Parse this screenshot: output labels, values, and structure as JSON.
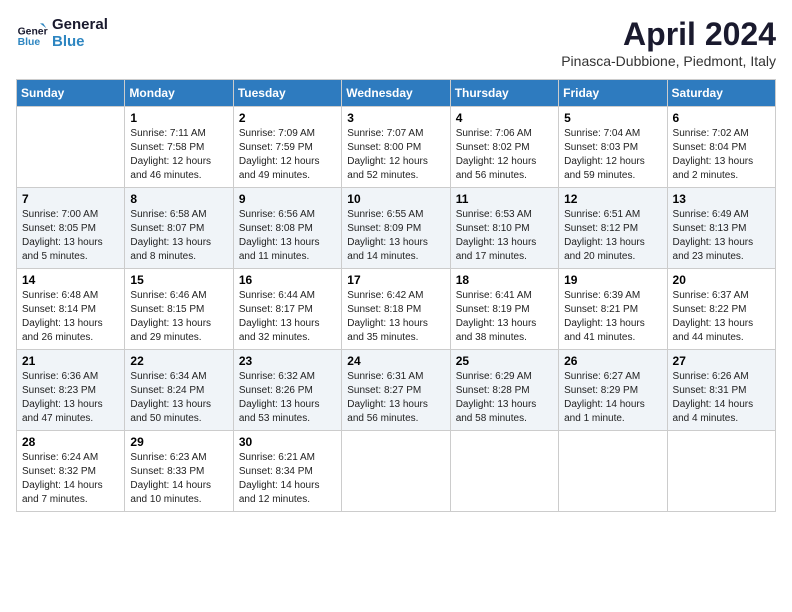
{
  "header": {
    "logo_line1": "General",
    "logo_line2": "Blue",
    "title": "April 2024",
    "subtitle": "Pinasca-Dubbione, Piedmont, Italy"
  },
  "days_of_week": [
    "Sunday",
    "Monday",
    "Tuesday",
    "Wednesday",
    "Thursday",
    "Friday",
    "Saturday"
  ],
  "weeks": [
    [
      {
        "day": "",
        "info": ""
      },
      {
        "day": "1",
        "info": "Sunrise: 7:11 AM\nSunset: 7:58 PM\nDaylight: 12 hours\nand 46 minutes."
      },
      {
        "day": "2",
        "info": "Sunrise: 7:09 AM\nSunset: 7:59 PM\nDaylight: 12 hours\nand 49 minutes."
      },
      {
        "day": "3",
        "info": "Sunrise: 7:07 AM\nSunset: 8:00 PM\nDaylight: 12 hours\nand 52 minutes."
      },
      {
        "day": "4",
        "info": "Sunrise: 7:06 AM\nSunset: 8:02 PM\nDaylight: 12 hours\nand 56 minutes."
      },
      {
        "day": "5",
        "info": "Sunrise: 7:04 AM\nSunset: 8:03 PM\nDaylight: 12 hours\nand 59 minutes."
      },
      {
        "day": "6",
        "info": "Sunrise: 7:02 AM\nSunset: 8:04 PM\nDaylight: 13 hours\nand 2 minutes."
      }
    ],
    [
      {
        "day": "7",
        "info": "Sunrise: 7:00 AM\nSunset: 8:05 PM\nDaylight: 13 hours\nand 5 minutes."
      },
      {
        "day": "8",
        "info": "Sunrise: 6:58 AM\nSunset: 8:07 PM\nDaylight: 13 hours\nand 8 minutes."
      },
      {
        "day": "9",
        "info": "Sunrise: 6:56 AM\nSunset: 8:08 PM\nDaylight: 13 hours\nand 11 minutes."
      },
      {
        "day": "10",
        "info": "Sunrise: 6:55 AM\nSunset: 8:09 PM\nDaylight: 13 hours\nand 14 minutes."
      },
      {
        "day": "11",
        "info": "Sunrise: 6:53 AM\nSunset: 8:10 PM\nDaylight: 13 hours\nand 17 minutes."
      },
      {
        "day": "12",
        "info": "Sunrise: 6:51 AM\nSunset: 8:12 PM\nDaylight: 13 hours\nand 20 minutes."
      },
      {
        "day": "13",
        "info": "Sunrise: 6:49 AM\nSunset: 8:13 PM\nDaylight: 13 hours\nand 23 minutes."
      }
    ],
    [
      {
        "day": "14",
        "info": "Sunrise: 6:48 AM\nSunset: 8:14 PM\nDaylight: 13 hours\nand 26 minutes."
      },
      {
        "day": "15",
        "info": "Sunrise: 6:46 AM\nSunset: 8:15 PM\nDaylight: 13 hours\nand 29 minutes."
      },
      {
        "day": "16",
        "info": "Sunrise: 6:44 AM\nSunset: 8:17 PM\nDaylight: 13 hours\nand 32 minutes."
      },
      {
        "day": "17",
        "info": "Sunrise: 6:42 AM\nSunset: 8:18 PM\nDaylight: 13 hours\nand 35 minutes."
      },
      {
        "day": "18",
        "info": "Sunrise: 6:41 AM\nSunset: 8:19 PM\nDaylight: 13 hours\nand 38 minutes."
      },
      {
        "day": "19",
        "info": "Sunrise: 6:39 AM\nSunset: 8:21 PM\nDaylight: 13 hours\nand 41 minutes."
      },
      {
        "day": "20",
        "info": "Sunrise: 6:37 AM\nSunset: 8:22 PM\nDaylight: 13 hours\nand 44 minutes."
      }
    ],
    [
      {
        "day": "21",
        "info": "Sunrise: 6:36 AM\nSunset: 8:23 PM\nDaylight: 13 hours\nand 47 minutes."
      },
      {
        "day": "22",
        "info": "Sunrise: 6:34 AM\nSunset: 8:24 PM\nDaylight: 13 hours\nand 50 minutes."
      },
      {
        "day": "23",
        "info": "Sunrise: 6:32 AM\nSunset: 8:26 PM\nDaylight: 13 hours\nand 53 minutes."
      },
      {
        "day": "24",
        "info": "Sunrise: 6:31 AM\nSunset: 8:27 PM\nDaylight: 13 hours\nand 56 minutes."
      },
      {
        "day": "25",
        "info": "Sunrise: 6:29 AM\nSunset: 8:28 PM\nDaylight: 13 hours\nand 58 minutes."
      },
      {
        "day": "26",
        "info": "Sunrise: 6:27 AM\nSunset: 8:29 PM\nDaylight: 14 hours\nand 1 minute."
      },
      {
        "day": "27",
        "info": "Sunrise: 6:26 AM\nSunset: 8:31 PM\nDaylight: 14 hours\nand 4 minutes."
      }
    ],
    [
      {
        "day": "28",
        "info": "Sunrise: 6:24 AM\nSunset: 8:32 PM\nDaylight: 14 hours\nand 7 minutes."
      },
      {
        "day": "29",
        "info": "Sunrise: 6:23 AM\nSunset: 8:33 PM\nDaylight: 14 hours\nand 10 minutes."
      },
      {
        "day": "30",
        "info": "Sunrise: 6:21 AM\nSunset: 8:34 PM\nDaylight: 14 hours\nand 12 minutes."
      },
      {
        "day": "",
        "info": ""
      },
      {
        "day": "",
        "info": ""
      },
      {
        "day": "",
        "info": ""
      },
      {
        "day": "",
        "info": ""
      }
    ]
  ]
}
